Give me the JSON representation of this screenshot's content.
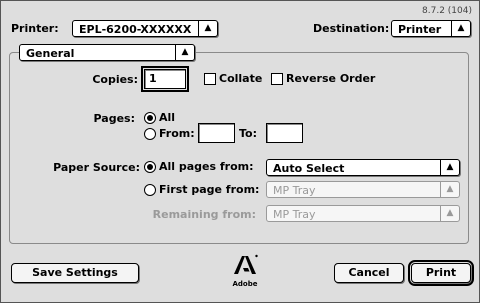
{
  "version": "8.7.2 (104)",
  "printer": {
    "label": "Printer:",
    "value": "EPL-6200-XXXXXX"
  },
  "destination": {
    "label": "Destination:",
    "value": "Printer"
  },
  "panel": {
    "value": "General"
  },
  "copies": {
    "label": "Copies:",
    "value": "1"
  },
  "collate": {
    "label": "Collate",
    "checked": false
  },
  "reverse_order": {
    "label": "Reverse Order",
    "checked": false
  },
  "pages": {
    "label": "Pages:",
    "all_label": "All",
    "from_label": "From:",
    "to_label": "To:",
    "from_value": "",
    "to_value": "",
    "selected": "all"
  },
  "paper_source": {
    "label": "Paper Source:",
    "all_pages_label": "All pages from:",
    "all_pages_value": "Auto Select",
    "first_page_label": "First page from:",
    "first_page_value": "MP Tray",
    "remaining_label": "Remaining from:",
    "remaining_value": "MP Tray",
    "selected": "all_pages"
  },
  "logo": {
    "text": "Adobe"
  },
  "buttons": {
    "save_settings": "Save Settings",
    "cancel": "Cancel",
    "print": "Print"
  }
}
